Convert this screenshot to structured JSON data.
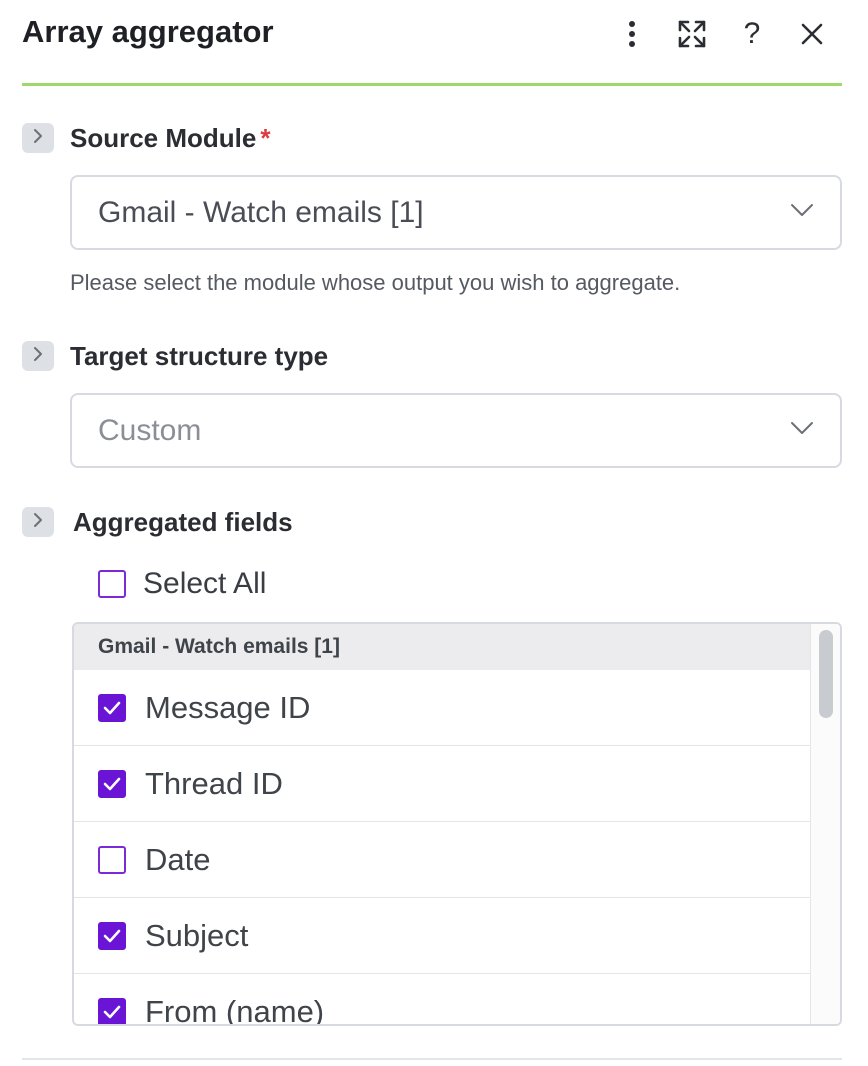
{
  "header": {
    "title": "Array aggregator",
    "icons": [
      "more-vertical-icon",
      "expand-icon",
      "help-icon",
      "close-icon"
    ],
    "help_glyph": "?",
    "accent_color": "#9fd86b"
  },
  "source_module": {
    "label": "Source Module",
    "required_mark": "*",
    "value": "Gmail - Watch emails [1]",
    "help_text": "Please select the module whose output you wish to aggregate."
  },
  "target_structure": {
    "label": "Target structure type",
    "value": "Custom"
  },
  "aggregated_fields": {
    "label": "Aggregated fields",
    "select_all_label": "Select All",
    "select_all_checked": false,
    "group_name": "Gmail - Watch emails [1]",
    "items": [
      {
        "label": "Message ID",
        "checked": true
      },
      {
        "label": "Thread ID",
        "checked": true
      },
      {
        "label": "Date",
        "checked": false
      },
      {
        "label": "Subject",
        "checked": true
      },
      {
        "label": "From (name)",
        "checked": true
      }
    ]
  },
  "colors": {
    "checkbox_checked": "#6a14d6",
    "required": "#e0383e"
  }
}
